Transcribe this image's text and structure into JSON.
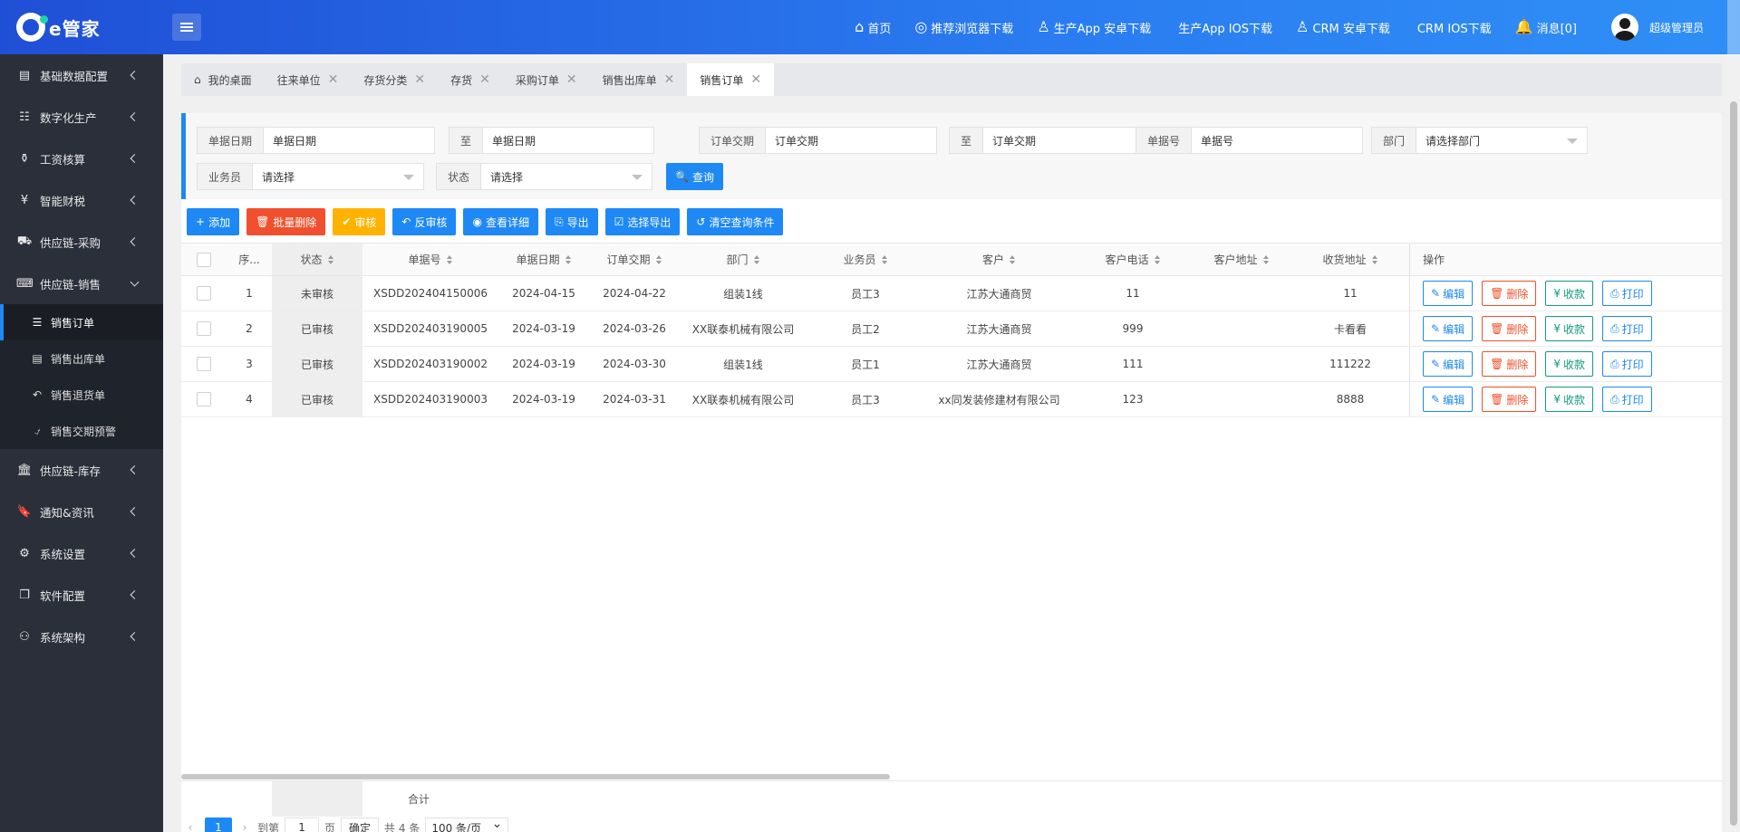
{
  "header": {
    "logo_text": "e管家",
    "nav": [
      {
        "icon": "⌂",
        "label": "首页"
      },
      {
        "icon": "◎",
        "label": "推荐浏览器下载"
      },
      {
        "icon": "♙",
        "label": "生产App 安卓下载"
      },
      {
        "icon": "",
        "label": "生产App IOS下载"
      },
      {
        "icon": "♙",
        "label": "CRM 安卓下载"
      },
      {
        "icon": "",
        "label": "CRM IOS下载"
      },
      {
        "icon": "🔔",
        "label": "消息[0]"
      }
    ],
    "user": "超级管理员"
  },
  "sidebar": {
    "items": [
      {
        "icon": "▤",
        "label": "基础数据配置"
      },
      {
        "icon": "☷",
        "label": "数字化生产"
      },
      {
        "icon": "⚱",
        "label": "工资核算"
      },
      {
        "icon": "¥",
        "label": "智能财税"
      },
      {
        "icon": "⛟",
        "label": "供应链-采购"
      },
      {
        "icon": "⌨",
        "label": "供应链-销售"
      }
    ],
    "sub_items": [
      {
        "icon": "☰",
        "label": "销售订单"
      },
      {
        "icon": "▤",
        "label": "销售出库单"
      },
      {
        "icon": "↶",
        "label": "销售退货单"
      },
      {
        "icon": "⍻",
        "label": "销售交期预警"
      }
    ],
    "items_after": [
      {
        "icon": "🏛",
        "label": "供应链-库存"
      },
      {
        "icon": "🔖",
        "label": "通知&资讯"
      },
      {
        "icon": "⚙",
        "label": "系统设置"
      },
      {
        "icon": "❐",
        "label": "软件配置"
      },
      {
        "icon": "⚇",
        "label": "系统架构"
      }
    ]
  },
  "tabs": [
    {
      "label": "我的桌面",
      "icon": "⌂"
    },
    {
      "label": "往来单位",
      "close": "✕"
    },
    {
      "label": "存货分类",
      "close": "✕"
    },
    {
      "label": "存货",
      "close": "✕"
    },
    {
      "label": "采购订单",
      "close": "✕"
    },
    {
      "label": "销售出库单",
      "close": "✕"
    },
    {
      "label": "销售订单",
      "close": "✕"
    }
  ],
  "filters": {
    "bill_date_label": "单据日期",
    "bill_date_from": "单据日期",
    "to1": "至",
    "bill_date_to": "单据日期",
    "delivery_label": "订单交期",
    "delivery_from": "订单交期",
    "to2": "至",
    "delivery_to": "订单交期",
    "bill_no_label": "单据号",
    "bill_no": "单据号",
    "dept_label": "部门",
    "dept": "请选择部门",
    "salesman_label": "业务员",
    "salesman": "请选择",
    "status_label": "状态",
    "status": "请选择",
    "query": "查询"
  },
  "toolbar": {
    "add": "添加",
    "batch_delete": "批量删除",
    "audit": "审核",
    "unaudit": "反审核",
    "view_detail": "查看详细",
    "export": "导出",
    "select_export": "选择导出",
    "clear": "清空查询条件"
  },
  "table": {
    "headers": {
      "seq": "序...",
      "status": "状态",
      "bill_no": "单据号",
      "bill_date": "单据日期",
      "delivery": "订单交期",
      "dept": "部门",
      "salesman": "业务员",
      "customer": "客户",
      "phone": "客户电话",
      "address": "客户地址",
      "ship_addr": "收货地址",
      "ops": "操作"
    },
    "rows": [
      {
        "seq": "1",
        "status": "未审核",
        "bill_no": "XSDD202404150006",
        "bill_date": "2024-04-15",
        "delivery": "2024-04-22",
        "dept": "组装1线",
        "salesman": "员工3",
        "customer": "江苏大通商贸",
        "phone": "11",
        "address": "",
        "ship_addr": "11"
      },
      {
        "seq": "2",
        "status": "已审核",
        "bill_no": "XSDD202403190005",
        "bill_date": "2024-03-19",
        "delivery": "2024-03-26",
        "dept": "XX联泰机械有限公司",
        "salesman": "员工2",
        "customer": "江苏大通商贸",
        "phone": "999",
        "address": "",
        "ship_addr": "卡看看"
      },
      {
        "seq": "3",
        "status": "已审核",
        "bill_no": "XSDD202403190002",
        "bill_date": "2024-03-19",
        "delivery": "2024-03-30",
        "dept": "组装1线",
        "salesman": "员工1",
        "customer": "江苏大通商贸",
        "phone": "111",
        "address": "",
        "ship_addr": "111222"
      },
      {
        "seq": "4",
        "status": "已审核",
        "bill_no": "XSDD202403190003",
        "bill_date": "2024-03-19",
        "delivery": "2024-03-31",
        "dept": "XX联泰机械有限公司",
        "salesman": "员工3",
        "customer": "xx同发装修建材有限公司",
        "phone": "123",
        "address": "",
        "ship_addr": "8888"
      }
    ],
    "row_actions": {
      "edit": "编辑",
      "delete": "删除",
      "receive": "收款",
      "print": "打印"
    }
  },
  "totals_label": "合计",
  "pager": {
    "prev": "‹",
    "current": "1",
    "next": "›",
    "goto": "到第",
    "page_input": "1",
    "page_unit": "页",
    "confirm": "确定",
    "total": "共 4 条",
    "per_page": "100 条/页"
  }
}
